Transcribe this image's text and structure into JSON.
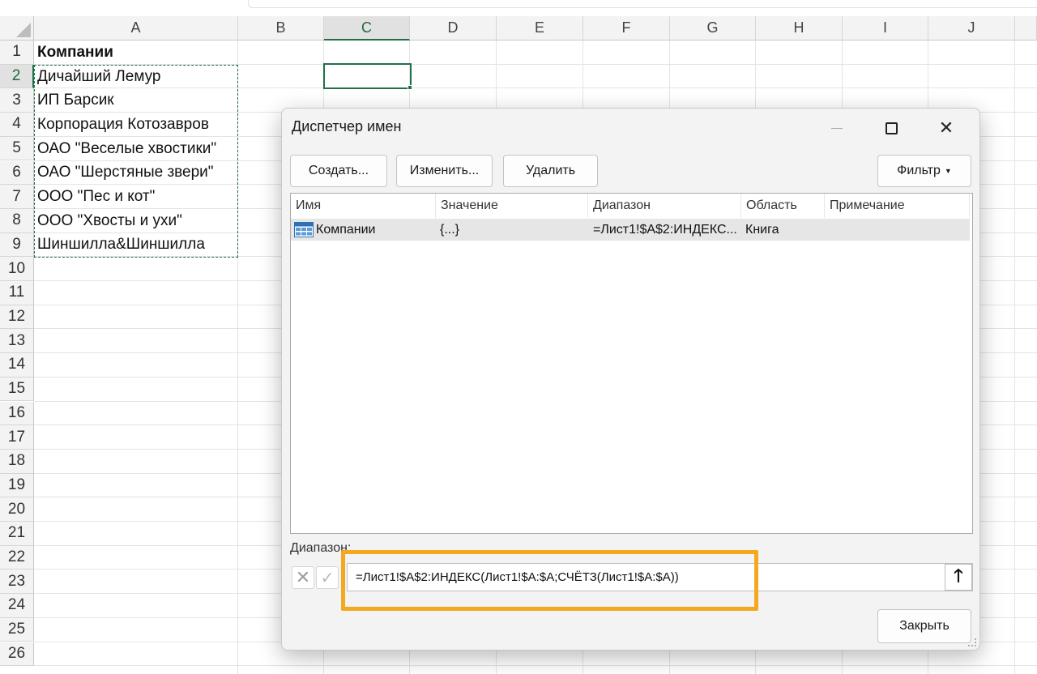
{
  "sheet": {
    "columns": [
      "A",
      "B",
      "C",
      "D",
      "E",
      "F",
      "G",
      "H",
      "I",
      "J"
    ],
    "selected_column": "C",
    "rows": [
      "1",
      "2",
      "3",
      "4",
      "5",
      "6",
      "7",
      "8",
      "9",
      "10",
      "11",
      "12",
      "13",
      "14",
      "15",
      "16",
      "17",
      "18",
      "19",
      "20",
      "21",
      "22",
      "23",
      "24",
      "25",
      "26"
    ],
    "selected_row": "2",
    "cells_a": [
      "Компании",
      "Дичайший Лемур",
      "ИП Барсик",
      "Корпорация Котозавров",
      "ОАО \"Веселые хвостики\"",
      "ОАО \"Шерстяные звери\"",
      "ООО \"Пес и кот\"",
      "ООО \"Хвосты и ухи\"",
      "Шиншилла&Шиншилла"
    ]
  },
  "dialog": {
    "title": "Диспетчер имен",
    "buttons": {
      "create": "Создать...",
      "edit": "Изменить...",
      "delete": "Удалить",
      "filter": "Фильтр"
    },
    "columns": {
      "name": "Имя",
      "value": "Значение",
      "range": "Диапазон",
      "scope": "Область",
      "comment": "Примечание"
    },
    "row": {
      "name": "Компании",
      "value": "{...}",
      "range": "=Лист1!$A$2:ИНДЕКС...",
      "scope": "Книга",
      "comment": ""
    },
    "ref_label": "Диапазон:",
    "ref_value": "=Лист1!$A$2:ИНДЕКС(Лист1!$A:$A;СЧЁТЗ(Лист1!$A:$A))",
    "close_label": "Закрыть",
    "highlight_color": "#f4a81d",
    "accent_color": "#1e7145"
  }
}
